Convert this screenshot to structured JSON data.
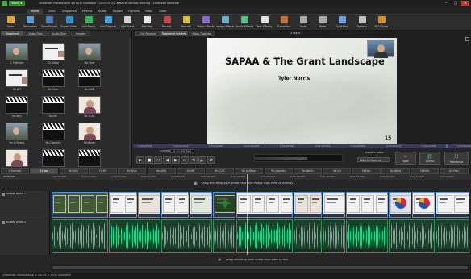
{
  "window": {
    "title": "VideoPad Professional by NCH Software - 2025-10-02-NatureGranted-new.vpj - Licensed software",
    "menu_button": "Menu ▾"
  },
  "menu_tabs": [
    "Home",
    "Clips",
    "Sequence",
    "Effects",
    "Audio",
    "Export",
    "Options",
    "Help",
    "Suite"
  ],
  "toolbar": [
    {
      "label": "Open",
      "icon": "folder-icon",
      "color": "#e0a83a"
    },
    {
      "label": "Templates",
      "icon": "templates-icon",
      "color": "#5aa0d8"
    },
    {
      "label": "Save Project",
      "icon": "save-icon",
      "color": "#4a7cc0"
    },
    {
      "label": "Export Video",
      "icon": "export-video-icon",
      "color": "#3a8fd0"
    },
    {
      "label": "Add File(s)",
      "icon": "add-file-icon",
      "color": "#3ab35a"
    },
    {
      "label": "Add Objects",
      "icon": "add-objects-icon",
      "color": "#49a3d8"
    },
    {
      "label": "Add Blank",
      "icon": "add-blank-icon",
      "color": "#cfcfcf"
    },
    {
      "label": "Add Text",
      "icon": "add-text-icon",
      "color": "#e8e8e8"
    },
    {
      "label": "Record",
      "icon": "record-icon",
      "color": "#d04040"
    },
    {
      "label": "Narrate",
      "icon": "narrate-icon",
      "color": "#d8c040"
    },
    {
      "label": "Video Effects",
      "icon": "video-effects-icon",
      "color": "#8a6ad0"
    },
    {
      "label": "Image Effects",
      "icon": "image-effects-icon",
      "color": "#6ab0d0"
    },
    {
      "label": "Audio Effects",
      "icon": "audio-effects-icon",
      "color": "#50c080"
    },
    {
      "label": "Text Effects",
      "icon": "text-effects-icon",
      "color": "#e0e0e0"
    },
    {
      "label": "Transition",
      "icon": "transition-icon",
      "color": "#c07040"
    },
    {
      "label": "Undo",
      "icon": "undo-icon",
      "color": "#aaaaaa"
    },
    {
      "label": "Redo",
      "icon": "redo-icon",
      "color": "#aaaaaa"
    },
    {
      "label": "Subtitles",
      "icon": "subtitles-icon",
      "color": "#70a0e0"
    },
    {
      "label": "Options",
      "icon": "options-icon",
      "color": "#c0c0c0"
    },
    {
      "label": "NCH Suite",
      "icon": "nch-suite-icon",
      "color": "#e08a30"
    }
  ],
  "left_tabs": [
    "Sequence",
    "Video Files",
    "Audio Files",
    "Images"
  ],
  "clips": [
    {
      "label": "C Fullniker",
      "kind": "photo"
    },
    {
      "label": "Ch Niato",
      "kind": "slide"
    },
    {
      "label": "Ga Tyler",
      "kind": "photo"
    },
    {
      "label": "9e-N/T",
      "kind": "slide"
    },
    {
      "label": "8e-Allen",
      "kind": "clapper"
    },
    {
      "label": "8e-ANN",
      "kind": "clapper"
    },
    {
      "label": "9e-Nilly",
      "kind": "clapper"
    },
    {
      "label": "8e-ME",
      "kind": "clapper"
    },
    {
      "label": "9e-Q-AC",
      "kind": "face"
    },
    {
      "label": "9e-Q-Ready",
      "kind": "photo"
    },
    {
      "label": "9e-Capacity",
      "kind": "clapper"
    },
    {
      "label": "9d-Worth",
      "kind": "face"
    },
    {
      "label": "Ga-Tyler",
      "kind": "face"
    },
    {
      "label": "8e-Norris",
      "kind": "clapper"
    },
    {
      "label": "",
      "kind": "clapper"
    }
  ],
  "preview": {
    "tabs": [
      "Clip Preview",
      "Sequence Preview",
      "Video Tutorials"
    ],
    "header": "3 Hasa",
    "slide_title": "SAPAA & The Grant Landscape",
    "slide_subtitle": "Tyler Norris",
    "slide_number": "15",
    "current_label": "Current:",
    "current_time": "0:01:56.769",
    "ruler": [
      "0:00:00.000",
      "0:00:20.000",
      "0:00:40.000",
      "0:01:00.000",
      "0:01:20.000",
      "0:01:40.000",
      "0:02:00.000",
      "0:02:20.000",
      "0:02:40.000",
      "0:03:00.000"
    ],
    "aspect_label": "Aspect Ratio",
    "aspect_value": "Match Content",
    "split_label": "Split",
    "unlink_label": "Unlink",
    "maximize_label": "Maximize"
  },
  "sequence_tabs": [
    "C Fullniker",
    "3 Hasa",
    "9e-Tyler",
    "7e-NT",
    "8e-Allen",
    "8e-ANN",
    "9e-ME",
    "9e-Q-AC",
    "9e-Q-Ready",
    "9e-Capacity",
    "9e-Worth",
    "9e-Cal",
    "9f-Sion",
    "9p-Warld",
    "9i-Kirsh",
    "Ga-Tyler"
  ],
  "timeline": {
    "label": "Timeline",
    "drop_video_hint": "Drag and drop your video, text and image clips here to overlay",
    "drop_audio_hint": "Drag and drop your audio clips here to mix",
    "video_track": "Video Track 1",
    "audio_track": "Audio Track 1",
    "times": [
      "0:00:10.000",
      "0:00:20.000",
      "0:00:30.000",
      "0:00:40.000",
      "0:00:50.000",
      "0:01:00.000",
      "0:01:10.000",
      "0:01:20.000",
      "0:01:30.000",
      "0:01:40.000",
      "0:01:50.000",
      "0:02:00.000",
      "0:02:10.000",
      "0:02:20.000"
    ]
  },
  "status": "VideoPad Professional v 16.09 © NCH Software"
}
